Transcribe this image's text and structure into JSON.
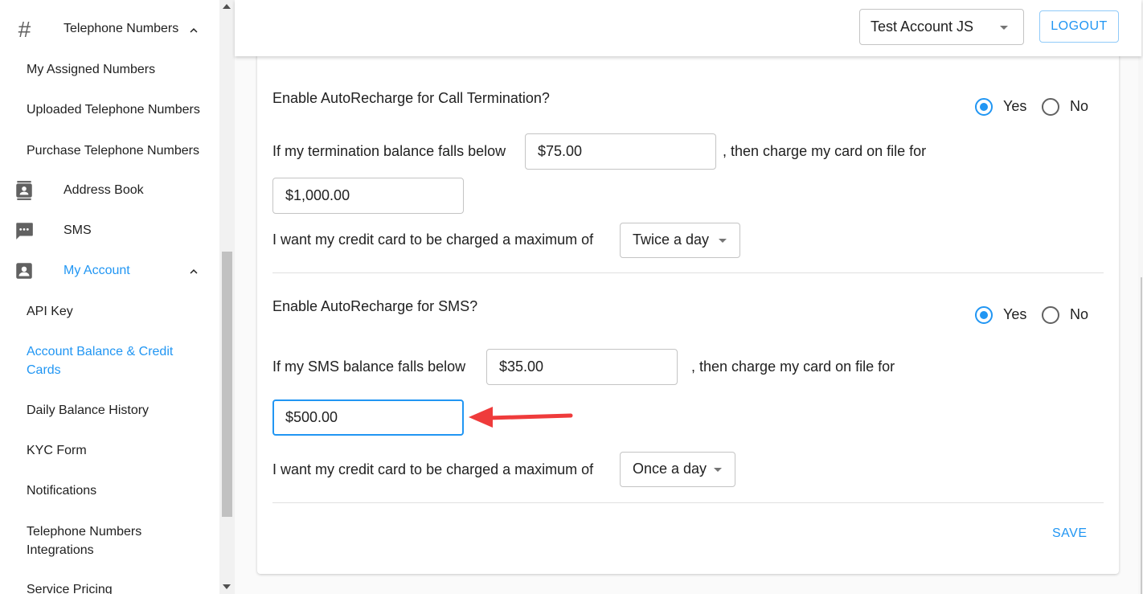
{
  "sidebar": {
    "telephone_numbers": "Telephone Numbers",
    "my_assigned_numbers": "My Assigned Numbers",
    "uploaded_numbers": "Uploaded Telephone Numbers",
    "purchase_numbers": "Purchase Telephone Numbers",
    "address_book": "Address Book",
    "sms": "SMS",
    "my_account": "My Account",
    "api_key": "API Key",
    "account_balance_line1": "Account Balance & Credit",
    "account_balance_line2": "Cards",
    "daily_balance_history": "Daily Balance History",
    "kyc_form": "KYC Form",
    "notifications": "Notifications",
    "integrations_line1": "Telephone Numbers",
    "integrations_line2": "Integrations",
    "service_pricing": "Service Pricing",
    "hash_glyph": "#",
    "icons": {
      "telephone_numbers": "hash-icon",
      "address_book": "address-book-icon",
      "sms": "sms-icon",
      "my_account": "account-box-icon"
    }
  },
  "header": {
    "account_selected": "Test Account JS",
    "logout_label": "LOGOUT"
  },
  "termination": {
    "question": "Enable AutoRecharge for Call Termination?",
    "yes_label": "Yes",
    "no_label": "No",
    "selected": "Yes",
    "falls_below_text": "If my termination balance falls below",
    "threshold_value": "$75.00",
    "then_charge_text": ", then charge my card on file for",
    "charge_amount": "$1,000.00",
    "max_text": "I want my credit card to be charged a maximum of",
    "frequency": "Twice a day"
  },
  "sms": {
    "question": "Enable AutoRecharge for SMS?",
    "yes_label": "Yes",
    "no_label": "No",
    "selected": "Yes",
    "falls_below_text": "If my SMS balance falls below",
    "threshold_value": "$35.00",
    "then_charge_text": ", then charge my card on file for",
    "charge_amount": "$500.00",
    "max_text": "I want my credit card to be charged a maximum of",
    "frequency": "Once a day"
  },
  "save_label": "SAVE",
  "colors": {
    "accent": "#2196f3",
    "annotation_arrow": "#ef3b3b"
  }
}
